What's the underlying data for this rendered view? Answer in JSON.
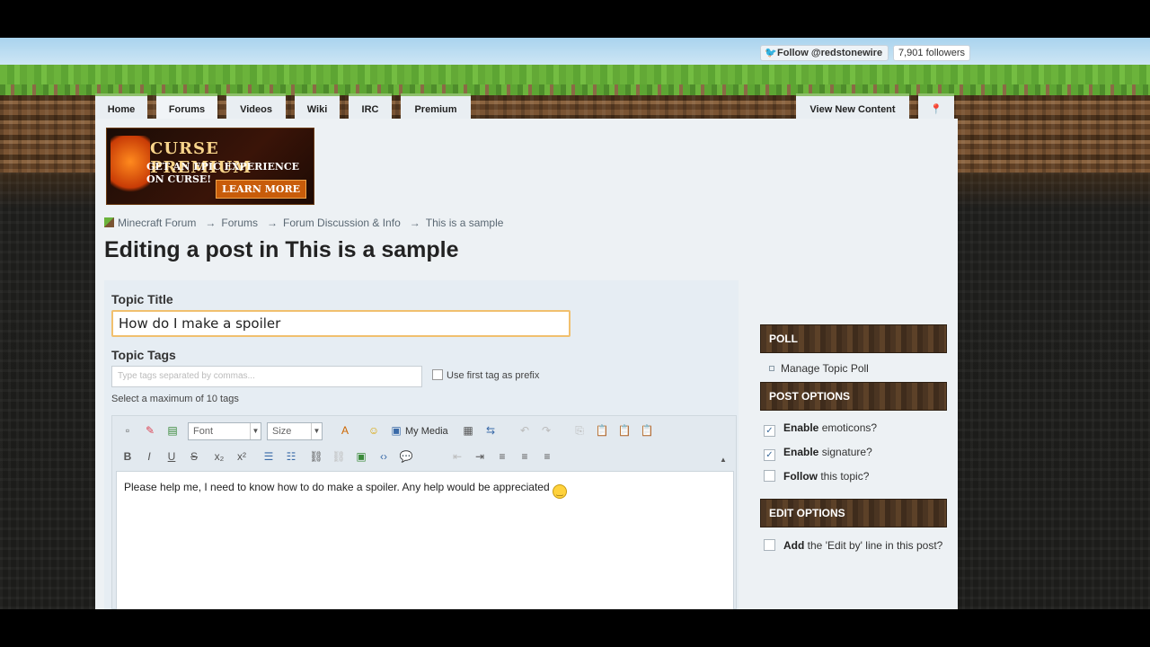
{
  "header": {
    "follow_label": "Follow @redstonewire",
    "followers": "7,901 followers"
  },
  "nav": {
    "tabs": [
      "Home",
      "Forums",
      "Videos",
      "Wiki",
      "IRC",
      "Premium"
    ],
    "active": "Forums",
    "view_new": "View New Content",
    "pin_icon": "map-pin-icon"
  },
  "banner": {
    "title": "CURSE PREMIUM",
    "line1": "GET AN EPIC EXPERIENCE",
    "line2": "ON CURSE!",
    "cta": "LEARN MORE"
  },
  "breadcrumb": [
    "Minecraft Forum",
    "Forums",
    "Forum Discussion & Info",
    "This is a sample"
  ],
  "page_title": "Editing a post in This is a sample",
  "form": {
    "topic_title_label": "Topic Title",
    "topic_title_value": "How do I make a spoiler",
    "topic_tags_label": "Topic Tags",
    "tags_placeholder": "Type tags separated by commas...",
    "prefix_label": "Use first tag as prefix",
    "tags_hint": "Select a maximum of 10 tags"
  },
  "editor": {
    "font_select": "Font",
    "size_select": "Size",
    "my_media": "My Media",
    "body_text": "Please help me, I need to know how to do make a spoiler. Any help would be appreciated"
  },
  "sidebar": {
    "poll_head": "POLL",
    "manage_poll": "Manage Topic Poll",
    "post_options_head": "POST OPTIONS",
    "post_options": [
      {
        "bold": "Enable",
        "rest": "emoticons?",
        "checked": true
      },
      {
        "bold": "Enable",
        "rest": "signature?",
        "checked": true
      },
      {
        "bold": "Follow",
        "rest": "this topic?",
        "checked": false
      }
    ],
    "edit_options_head": "EDIT OPTIONS",
    "edit_by_bold": "Add",
    "edit_by_rest": "the 'Edit by' line in this post?"
  }
}
